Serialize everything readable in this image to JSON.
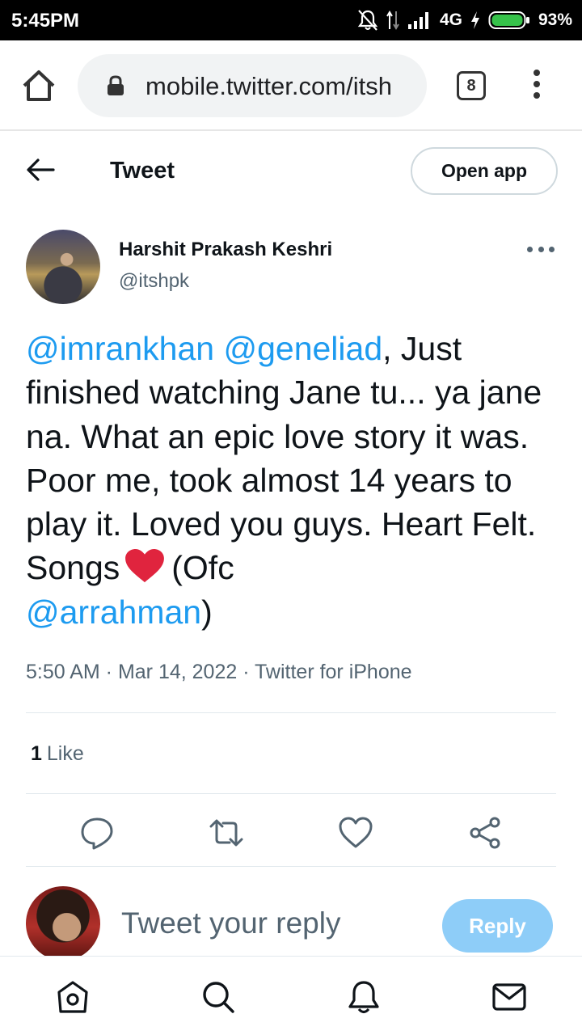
{
  "status_bar": {
    "time": "5:45PM",
    "network": "4G",
    "battery": "93%",
    "icons": [
      "mute-icon",
      "data-arrows-icon",
      "signal-icon",
      "charging-icon",
      "battery-icon"
    ]
  },
  "browser": {
    "url": "mobile.twitter.com/itsh",
    "tab_count": "8"
  },
  "header": {
    "title": "Tweet",
    "open_app_label": "Open app"
  },
  "tweet": {
    "author_name": "Harshit Prakash Keshri",
    "author_handle": "@itshpk",
    "text_parts": {
      "mention1": "@imrankhan",
      "space1": " ",
      "mention2": "@geneliad",
      "body": ", Just finished watching Jane tu... ya jane na. What an epic love story it was. Poor me, took almost 14 years to play it. Loved you guys. Heart Felt. Songs",
      "after_heart": "(Ofc",
      "mention3": "@arrahman",
      "closing": ")"
    },
    "meta": "5:50 AM · Mar 14, 2022 · Twitter for iPhone",
    "like_count": "1",
    "like_label": "Like"
  },
  "reply": {
    "placeholder": "Tweet your reply",
    "button_label": "Reply"
  },
  "colors": {
    "accent": "#1d9bf0",
    "reply_button": "#8ecdf8",
    "secondary_text": "#536471",
    "heart": "#e0245e"
  }
}
